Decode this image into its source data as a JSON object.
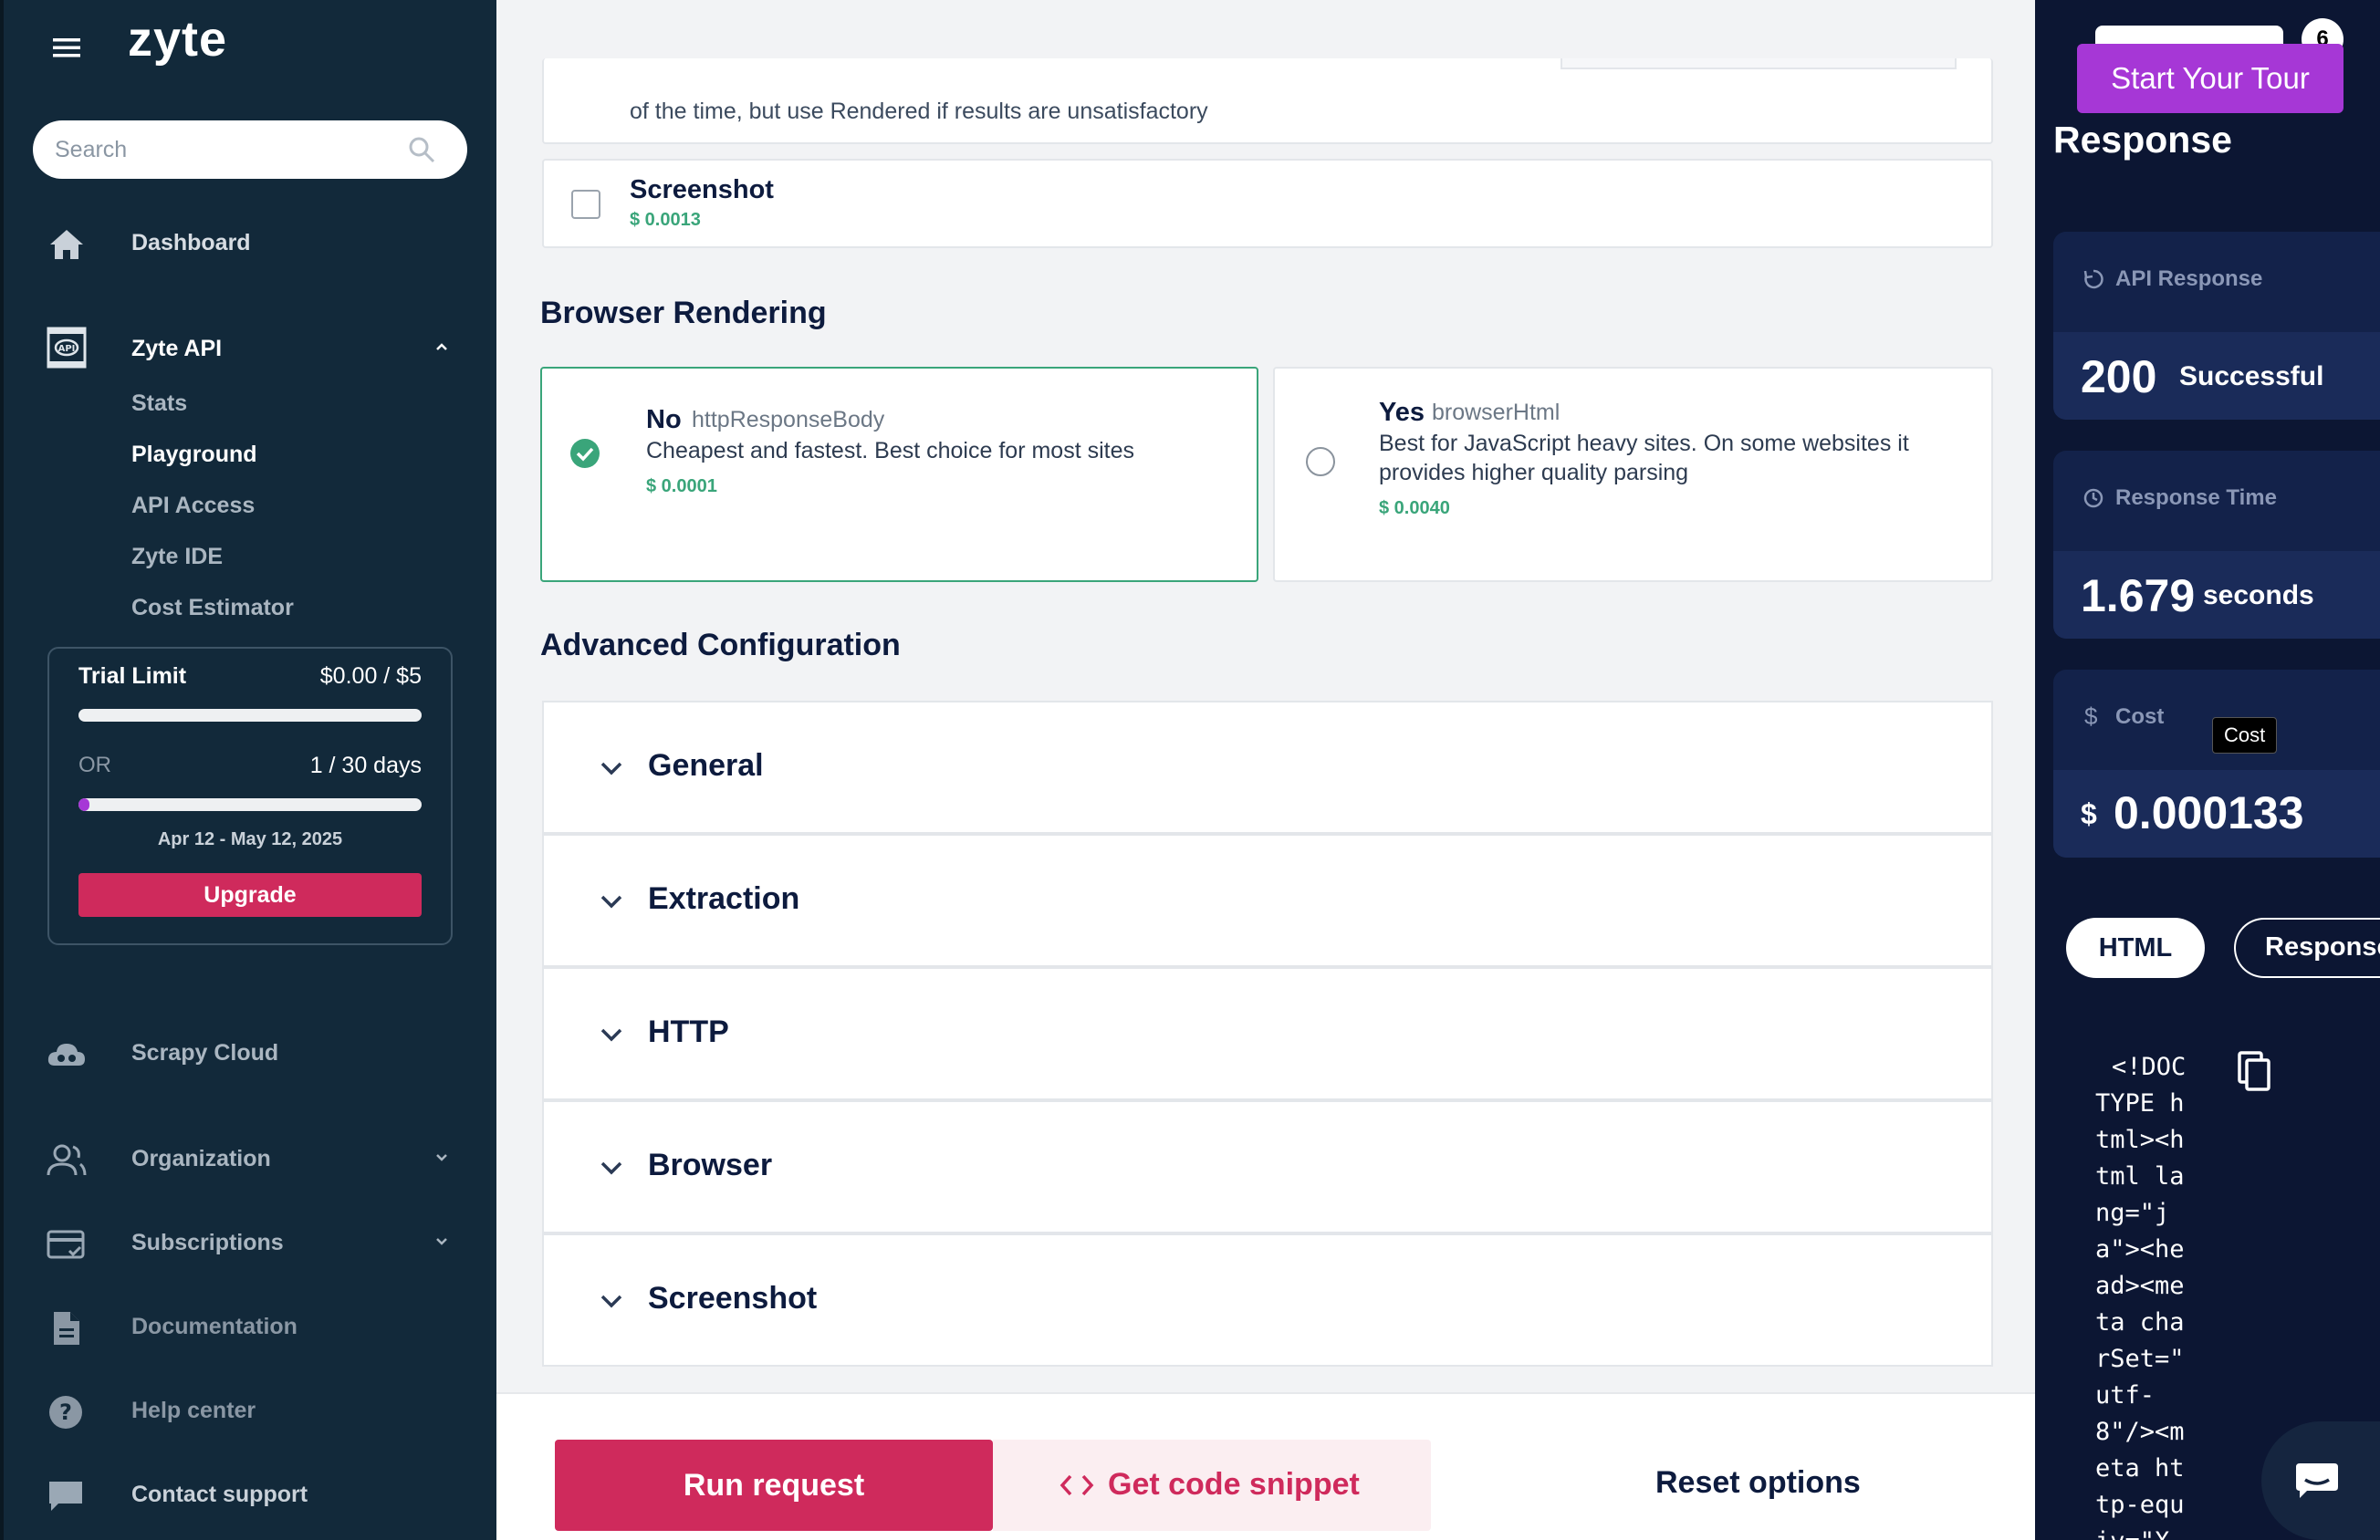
{
  "sidebar": {
    "logo": "zyte",
    "search_placeholder": "Search",
    "nav": {
      "dashboard": "Dashboard",
      "zyte_api": "Zyte API",
      "sub": [
        "Stats",
        "Playground",
        "API Access",
        "Zyte IDE",
        "Cost Estimator"
      ],
      "scrapy_cloud": "Scrapy Cloud",
      "organization": "Organization",
      "subscriptions": "Subscriptions",
      "documentation": "Documentation",
      "help_center": "Help center",
      "contact_support": "Contact support"
    },
    "trial": {
      "label": "Trial Limit",
      "amount": "$0.00 / $5",
      "amount_progress": 0.0,
      "or": "OR",
      "days": "1 / 30 days",
      "days_progress": 0.033,
      "dates": "Apr 12 - May 12, 2025",
      "upgrade": "Upgrade"
    }
  },
  "main": {
    "partial_text": "of the time, but use Rendered if results are unsatisfactory",
    "screenshot_option": {
      "title": "Screenshot",
      "price": "$ 0.0013",
      "checked": false
    },
    "browser_rendering": {
      "heading": "Browser Rendering",
      "no": {
        "title": "No",
        "sub": "httpResponseBody",
        "desc": "Cheapest and fastest. Best choice for most sites",
        "price": "$ 0.0001",
        "selected": true
      },
      "yes": {
        "title": "Yes",
        "sub": "browserHtml",
        "desc1": "Best for JavaScript heavy sites. On some websites it",
        "desc2": "provides higher quality parsing",
        "price": "$ 0.0040",
        "selected": false
      }
    },
    "advanced": {
      "heading": "Advanced Configuration",
      "sections": [
        "General",
        "Extraction",
        "HTTP",
        "Browser",
        "Screenshot"
      ]
    },
    "footer": {
      "run": "Run request",
      "snippet": "Get code snippet",
      "reset": "Reset options"
    }
  },
  "right": {
    "tour_badge": "6",
    "tour_button": "Start Your Tour",
    "title": "Response",
    "api_response": {
      "label": "API Response",
      "code": "200",
      "status": "Successful"
    },
    "response_time": {
      "label": "Response Time",
      "value": "1.679",
      "unit": "seconds"
    },
    "cost": {
      "label": "Cost",
      "tooltip": "Cost",
      "currency": "$",
      "value": "0.000133"
    },
    "tabs": [
      "HTML",
      "Response"
    ],
    "code_lines": [
      "<!DOC",
      "TYPE h",
      "tml><h",
      "tml la",
      "ng=\"j",
      "a\"><he",
      "ad><me",
      "ta cha",
      "rSet=\"",
      "utf-",
      "8\"/><m",
      "eta ht",
      "tp-equ",
      "iv=\"X"
    ]
  },
  "colors": {
    "sidebar_bg": "#12293a",
    "accent_pink": "#cf2a5c",
    "accent_green": "#3aa57a",
    "tour_purple": "#a637d6",
    "right_panel_bg": "#0c1633"
  },
  "icons": [
    "menu-icon",
    "search-icon",
    "home-icon",
    "api-icon",
    "chevron-up-icon",
    "cloud-icon",
    "users-icon",
    "card-icon",
    "document-icon",
    "help-icon",
    "chat-icon",
    "check-icon",
    "chevron-down-icon",
    "code-icon",
    "refresh-icon",
    "clock-icon",
    "dollar-icon",
    "copy-icon"
  ]
}
